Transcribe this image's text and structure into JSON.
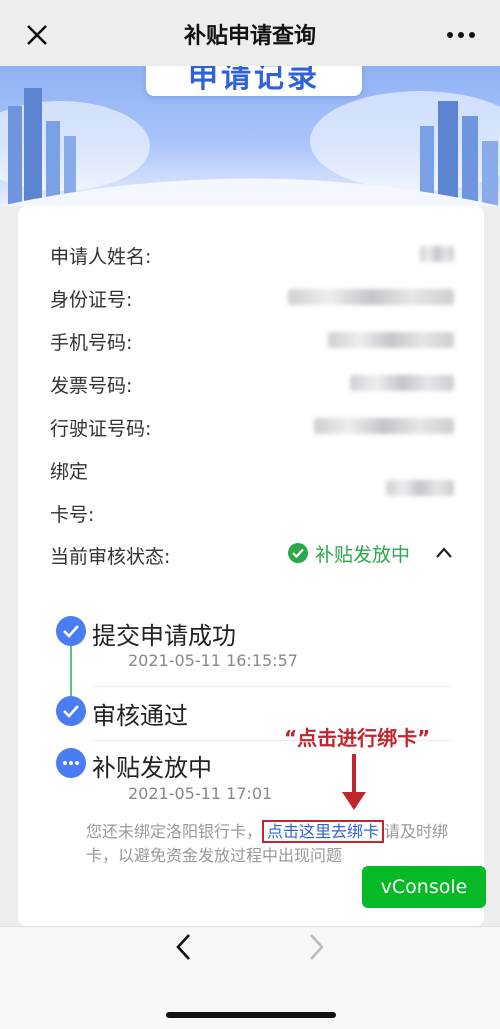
{
  "nav": {
    "title": "补贴申请查询"
  },
  "banner": {
    "title": "申请记录"
  },
  "fields": {
    "name_label": "申请人姓名:",
    "id_label": "身份证号:",
    "phone_label": "手机号码:",
    "invoice_label": "发票号码:",
    "license_label": "行驶证号码:",
    "bind_label": "绑定",
    "card_label": "卡号:",
    "status_label": "当前审核状态:"
  },
  "status": {
    "text": "补贴发放中",
    "color": "#2aa84a"
  },
  "timeline": [
    {
      "title": "提交申请成功",
      "time": "2021-05-11 16:15:57"
    },
    {
      "title": "审核通过",
      "time": ""
    },
    {
      "title": "补贴发放中",
      "time": "2021-05-11 17:01"
    }
  ],
  "annotation": "“点击进行绑卡”",
  "notice": {
    "prefix": "您还未绑定洛阳银行卡，",
    "link": "点击这里去绑卡",
    "suffix": "请及时绑卡，以避免资金发放过程中出现问题"
  },
  "vconsole": "vConsole",
  "colors": {
    "accent": "#4a7df3",
    "success": "#2aa84a",
    "annotation": "#c0262d",
    "link": "#2f62d8"
  }
}
